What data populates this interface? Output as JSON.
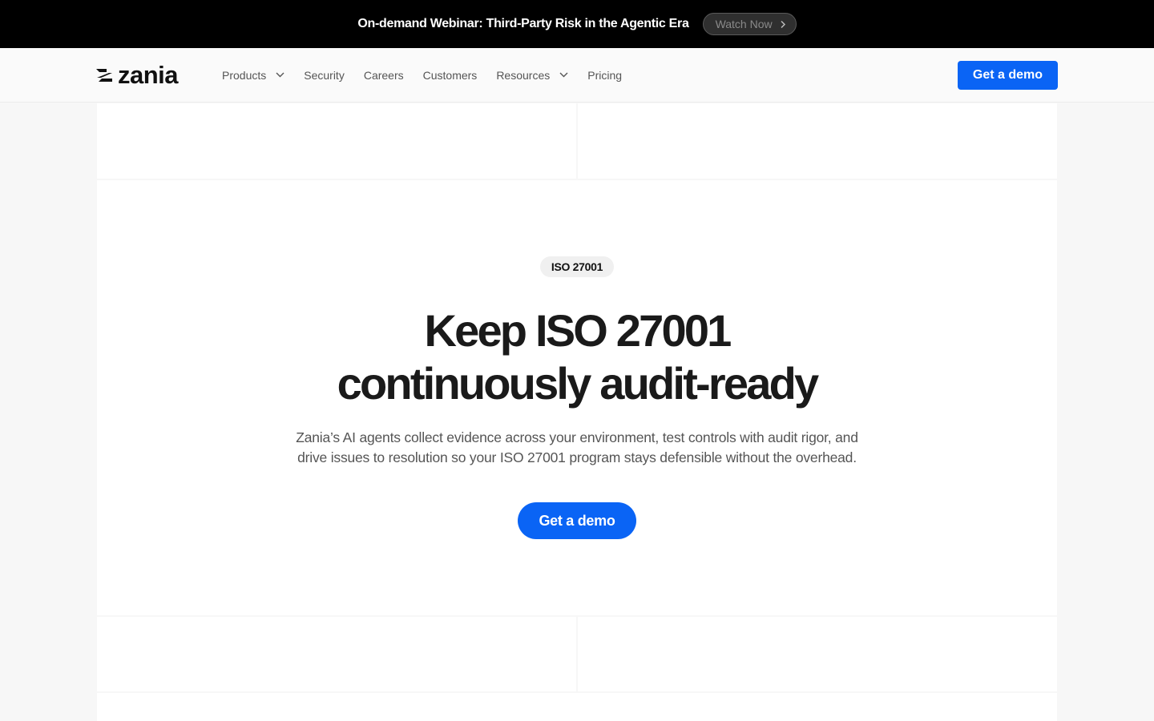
{
  "announcement": {
    "text": "On-demand Webinar: Third-Party Risk in the Agentic Era",
    "button_label": "Watch Now"
  },
  "header": {
    "logo_text": "zania",
    "nav": [
      {
        "label": "Products",
        "has_dropdown": true
      },
      {
        "label": "Security",
        "has_dropdown": false
      },
      {
        "label": "Careers",
        "has_dropdown": false
      },
      {
        "label": "Customers",
        "has_dropdown": false
      },
      {
        "label": "Resources",
        "has_dropdown": true
      },
      {
        "label": "Pricing",
        "has_dropdown": false
      }
    ],
    "cta_label": "Get a demo"
  },
  "hero": {
    "badge": "ISO 27001",
    "headline_line1": "Keep ISO 27001",
    "headline_line2": "continuously audit-ready",
    "subtext_line1": "Zania’s AI agents collect evidence across your environment, test controls with audit rigor, and",
    "subtext_line2": "drive issues to resolution so your ISO 27001 program stays defensible without the overhead.",
    "cta_label": "Get a demo"
  },
  "colors": {
    "accent": "#0a64f5",
    "announcement_bg": "#000000",
    "page_bg": "#f7f7f7"
  }
}
